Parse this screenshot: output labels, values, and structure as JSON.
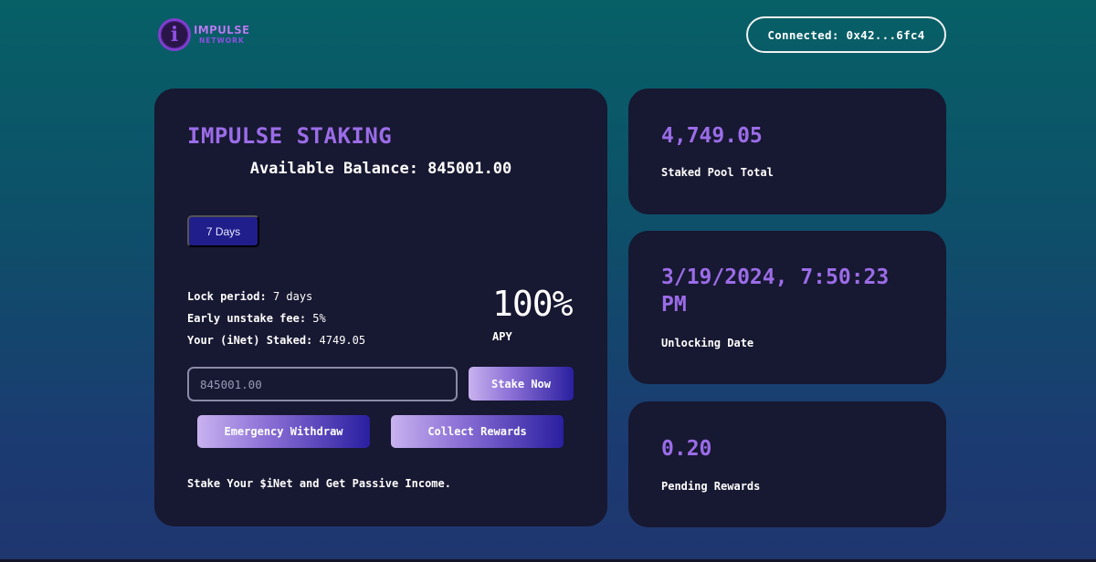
{
  "header": {
    "logo": {
      "mark": "i",
      "line1": "IMPULSE",
      "line2": "NETWORK",
      "icon": "impulse-logo-icon"
    },
    "connect_label": "Connected: 0x42...6fc4"
  },
  "staking": {
    "title": "IMPULSE STAKING",
    "balance": "Available Balance: 845001.00",
    "period_button": "7 Days",
    "info": [
      {
        "key": "Lock period:",
        "value": "7 days"
      },
      {
        "key": "Early unstake fee:",
        "value": "5%"
      },
      {
        "key": "Your (iNet) Staked:",
        "value": "4749.05"
      }
    ],
    "apy_value": "100%",
    "apy_label": "APY",
    "input_placeholder": "845001.00",
    "stake_button": "Stake Now",
    "emergency_button": "Emergency Withdraw",
    "collect_button": "Collect Rewards",
    "tagline": "Stake Your $iNet and Get Passive Income."
  },
  "stats": [
    {
      "value": "4,749.05",
      "label": "Staked Pool Total"
    },
    {
      "value": "3/19/2024, 7:50:23 PM",
      "label": "Unlocking Date"
    },
    {
      "value": "0.20",
      "label": "Pending Rewards"
    }
  ],
  "colors": {
    "accent": "#9b6ce8",
    "card_bg": "#171831",
    "button_blue": "#1f1e8b"
  }
}
